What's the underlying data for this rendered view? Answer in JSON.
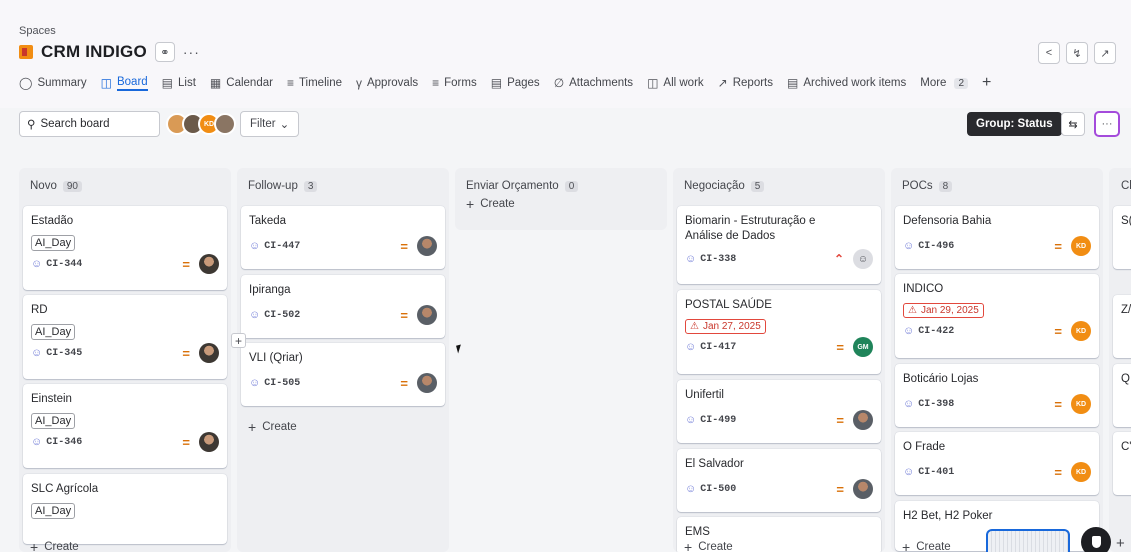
{
  "header": {
    "breadcrumb": "Spaces",
    "project_name": "CRM INDIGO"
  },
  "tabs": [
    {
      "label": "Summary",
      "icon": "globe-icon"
    },
    {
      "label": "Board",
      "icon": "board-icon"
    },
    {
      "label": "List",
      "icon": "list-icon"
    },
    {
      "label": "Calendar",
      "icon": "calendar-icon"
    },
    {
      "label": "Timeline",
      "icon": "timeline-icon"
    },
    {
      "label": "Approvals",
      "icon": "approvals-icon"
    },
    {
      "label": "Forms",
      "icon": "forms-icon"
    },
    {
      "label": "Pages",
      "icon": "pages-icon"
    },
    {
      "label": "Attachments",
      "icon": "attachment-icon"
    },
    {
      "label": "All work",
      "icon": "all-work-icon"
    },
    {
      "label": "Reports",
      "icon": "reports-icon"
    },
    {
      "label": "Archived work items",
      "icon": "archive-icon"
    }
  ],
  "tabs_more": {
    "label": "More",
    "count": "2"
  },
  "toolbar": {
    "search_placeholder": "Search board",
    "avatar_initials": "KD",
    "filter_label": "Filter",
    "group_label": "Group: Status"
  },
  "columns": [
    {
      "name": "Novo",
      "count": "90",
      "cards": [
        {
          "title": "Estadão",
          "label": "AI_Day",
          "key": "CI-344",
          "priority": "medium",
          "assignee": "photo"
        },
        {
          "title": "RD",
          "label": "AI_Day",
          "key": "CI-345",
          "priority": "medium",
          "assignee": "photo"
        },
        {
          "title": "Einstein",
          "label": "AI_Day",
          "key": "CI-346",
          "priority": "medium",
          "assignee": "photo"
        },
        {
          "title": "SLC Agrícola",
          "label": "AI_Day"
        }
      ],
      "create": "Create"
    },
    {
      "name": "Follow-up",
      "count": "3",
      "cards": [
        {
          "title": "Takeda",
          "key": "CI-447",
          "priority": "medium",
          "assignee": "photo2"
        },
        {
          "title": "Ipiranga",
          "key": "CI-502",
          "priority": "medium",
          "assignee": "photo2"
        },
        {
          "title": "VLI (Qriar)",
          "key": "CI-505",
          "priority": "medium",
          "assignee": "photo2"
        }
      ],
      "create": "Create"
    },
    {
      "name": "Enviar Orçamento",
      "count": "0",
      "cards": [],
      "create": "Create"
    },
    {
      "name": "Negociação",
      "count": "5",
      "cards": [
        {
          "title": "Biomarin - Estruturação e Análise de Dados",
          "key": "CI-338",
          "priority": "high",
          "assignee": "empty"
        },
        {
          "title": "POSTAL SAÚDE",
          "date": "Jan 27, 2025",
          "key": "CI-417",
          "priority": "medium",
          "assignee": "GM"
        },
        {
          "title": "Unifertil",
          "key": "CI-499",
          "priority": "medium",
          "assignee": "photo2"
        },
        {
          "title": "El Salvador",
          "key": "CI-500",
          "priority": "medium",
          "assignee": "photo2"
        },
        {
          "title": "EMS"
        }
      ],
      "create": "Create"
    },
    {
      "name": "POCs",
      "count": "8",
      "cards": [
        {
          "title": "Defensoria Bahia",
          "key": "CI-496",
          "priority": "medium",
          "assignee": "KD"
        },
        {
          "title": "INDICO",
          "date": "Jan 29, 2025",
          "key": "CI-422",
          "priority": "medium",
          "assignee": "KD"
        },
        {
          "title": "Boticário Lojas",
          "key": "CI-398",
          "priority": "medium",
          "assignee": "KD"
        },
        {
          "title": "O Frade",
          "key": "CI-401",
          "priority": "medium",
          "assignee": "KD"
        },
        {
          "title": "H2 Bet, H2 Poker"
        }
      ],
      "create": "Create"
    },
    {
      "name": "Cl",
      "cards": [
        {
          "title": "S("
        },
        {
          "title": "Z/"
        },
        {
          "title": "Q"
        },
        {
          "title": "C'"
        }
      ]
    }
  ],
  "colors": {
    "accent": "#1868db",
    "priority_medium": "#d97008",
    "priority_high": "#e2483d",
    "kd_avatar": "#f18d13",
    "gm_avatar": "#1f845a"
  }
}
